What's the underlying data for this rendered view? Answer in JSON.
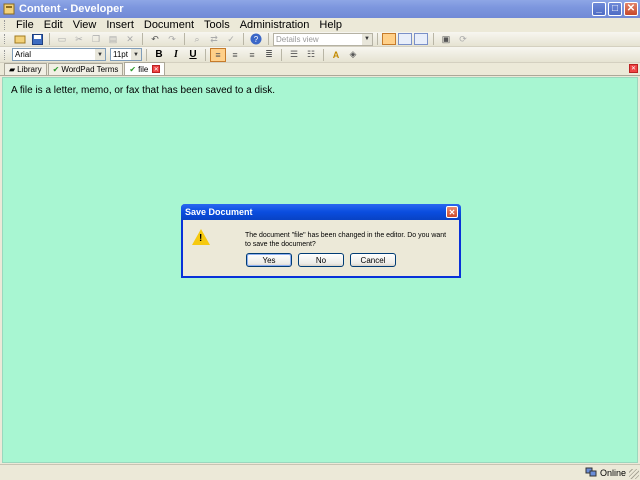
{
  "window": {
    "title": "Content - Developer"
  },
  "menu": [
    {
      "label": "File"
    },
    {
      "label": "Edit"
    },
    {
      "label": "View"
    },
    {
      "label": "Insert"
    },
    {
      "label": "Document"
    },
    {
      "label": "Tools"
    },
    {
      "label": "Administration"
    },
    {
      "label": "Help"
    }
  ],
  "toolbar": {
    "views_select": "Details view",
    "font": "Arial",
    "font_size": "11pt",
    "bold": "B",
    "italic": "I",
    "underline": "U"
  },
  "tabs": [
    {
      "label": "Library"
    },
    {
      "label": "WordPad Terms"
    },
    {
      "label": "file"
    }
  ],
  "document": {
    "text": "A file is a letter, memo, or fax that has been saved to a disk."
  },
  "dialog": {
    "title": "Save Document",
    "message": "The document \"file\" has been changed in the editor. Do you want to save the document?",
    "yes": "Yes",
    "no": "No",
    "cancel": "Cancel"
  },
  "status": {
    "online": "Online"
  },
  "colors": {
    "editor_bg": "#A8F6D2",
    "titlebar": "#7D97DE",
    "dialog_title": "#0A4DDF"
  }
}
